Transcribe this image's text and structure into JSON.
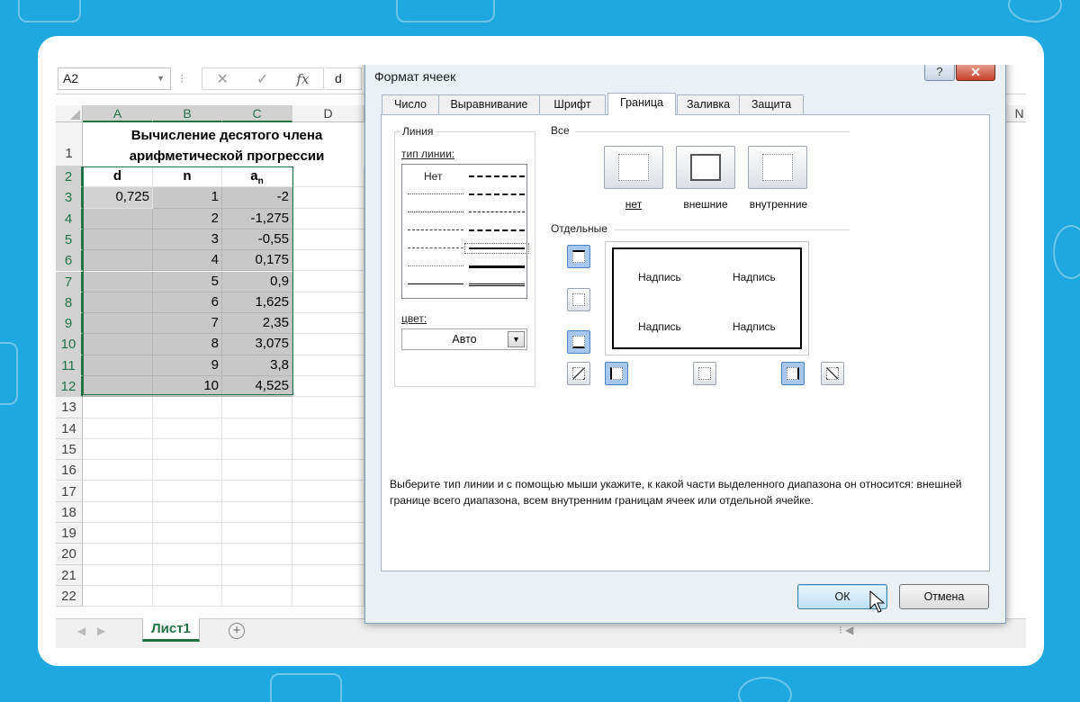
{
  "formula_bar": {
    "name_box": "A2",
    "dots": "⁝",
    "cancel": "✕",
    "enter": "✓",
    "fx": "fx",
    "value": "d"
  },
  "columns": [
    "A",
    "B",
    "C",
    "D"
  ],
  "right_col": "N",
  "rows": [
    "1",
    "2",
    "3",
    "4",
    "5",
    "6",
    "7",
    "8",
    "9",
    "10",
    "11",
    "12",
    "13",
    "14",
    "15",
    "16",
    "17",
    "18",
    "19",
    "20",
    "21",
    "22"
  ],
  "sheet": {
    "title_line1": "Вычисление десятого  члена",
    "title_line2": "арифметической прогрессии",
    "headers": {
      "d": "d",
      "n": "n",
      "a": "a",
      "a_sub": "n"
    },
    "d_value": "0,725",
    "n_values": [
      "1",
      "2",
      "3",
      "4",
      "5",
      "6",
      "7",
      "8",
      "9",
      "10"
    ],
    "a_values": [
      "-2",
      "-1,275",
      "-0,55",
      "0,175",
      "0,9",
      "1,625",
      "2,35",
      "3,075",
      "3,8",
      "4,525"
    ]
  },
  "sheet_tabs": {
    "active": "Лист1",
    "add": "+"
  },
  "dialog": {
    "title": "Формат ячеек",
    "help": "?",
    "close": "✕",
    "tabs": [
      "Число",
      "Выравнивание",
      "Шрифт",
      "Граница",
      "Заливка",
      "Защита"
    ],
    "active_tab": "Граница",
    "line_group": "Линия",
    "line_type_label": "тип линии:",
    "line_none": "Нет",
    "color_label": "цвет:",
    "color_value": "Авто",
    "all_group": "Все",
    "presets": [
      "нет",
      "внешние",
      "внутренние"
    ],
    "individual_group": "Отдельные",
    "preview_labels": [
      "Надпись",
      "Надпись",
      "Надпись",
      "Надпись"
    ],
    "hint": "Выберите тип линии и с помощью мыши укажите, к какой части выделенного диапазона он относится: внешней границе всего диапазона, всем внутренним границам ячеек или отдельной ячейке.",
    "ok": "ОК",
    "cancel": "Отмена"
  },
  "colors": {
    "accent": "#217346",
    "selection_fill": "#c8c8c8",
    "background": "#1fa7df",
    "dialog_border": "#7d9fc8"
  }
}
